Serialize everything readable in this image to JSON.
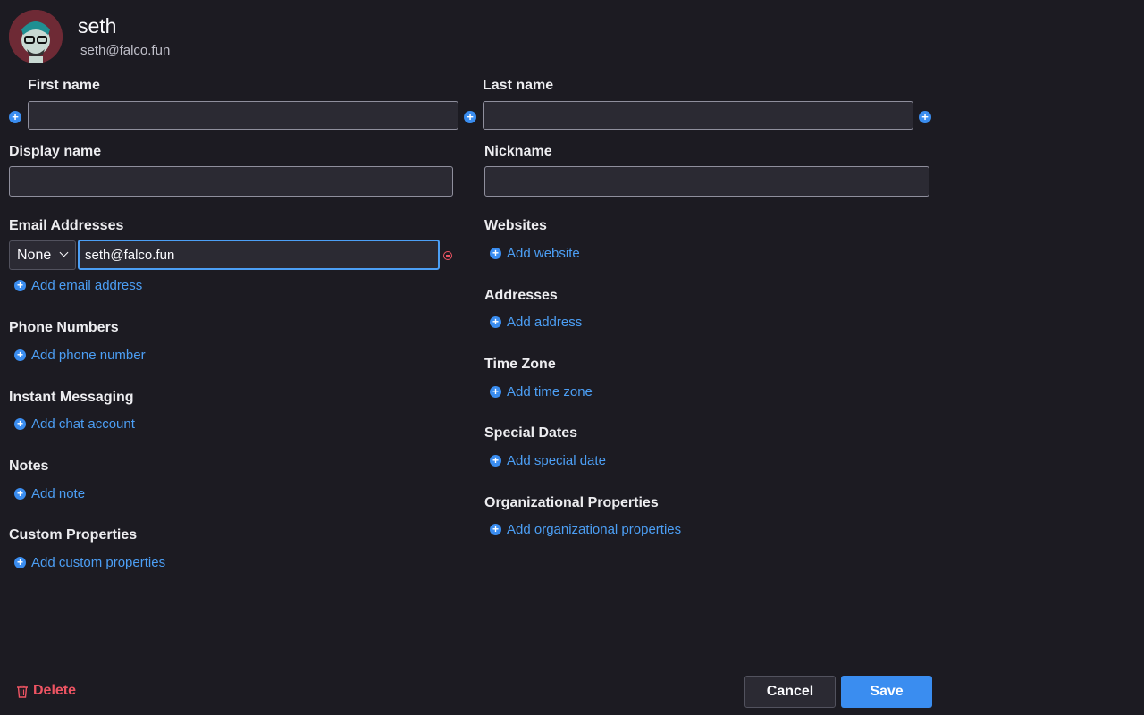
{
  "header": {
    "name": "seth",
    "email": "seth@falco.fun"
  },
  "fields": {
    "first_name_label": "First name",
    "first_name_value": "",
    "last_name_label": "Last name",
    "last_name_value": "",
    "display_name_label": "Display name",
    "display_name_value": "",
    "nickname_label": "Nickname",
    "nickname_value": ""
  },
  "email": {
    "section_label": "Email Addresses",
    "type_selected": "None",
    "value": "seth@falco.fun",
    "add_label": "Add email address"
  },
  "left_sections": [
    {
      "label": "Phone Numbers",
      "add_label": "Add phone number"
    },
    {
      "label": "Instant Messaging",
      "add_label": "Add chat account"
    },
    {
      "label": "Notes",
      "add_label": "Add note"
    },
    {
      "label": "Custom Properties",
      "add_label": "Add custom properties"
    }
  ],
  "right_sections": [
    {
      "label": "Websites",
      "add_label": "Add website"
    },
    {
      "label": "Addresses",
      "add_label": "Add address"
    },
    {
      "label": "Time Zone",
      "add_label": "Add time zone"
    },
    {
      "label": "Special Dates",
      "add_label": "Add special date"
    },
    {
      "label": "Organizational Properties",
      "add_label": "Add organizational properties"
    }
  ],
  "footer": {
    "delete_label": "Delete",
    "cancel_label": "Cancel",
    "save_label": "Save"
  },
  "colors": {
    "background": "#1c1b22",
    "accent": "#3a8df0",
    "link": "#4c9ff5",
    "danger": "#ee5463"
  },
  "icons": [
    "plus-circle-icon",
    "minus-circle-icon",
    "trash-icon",
    "chevron-down-icon"
  ]
}
